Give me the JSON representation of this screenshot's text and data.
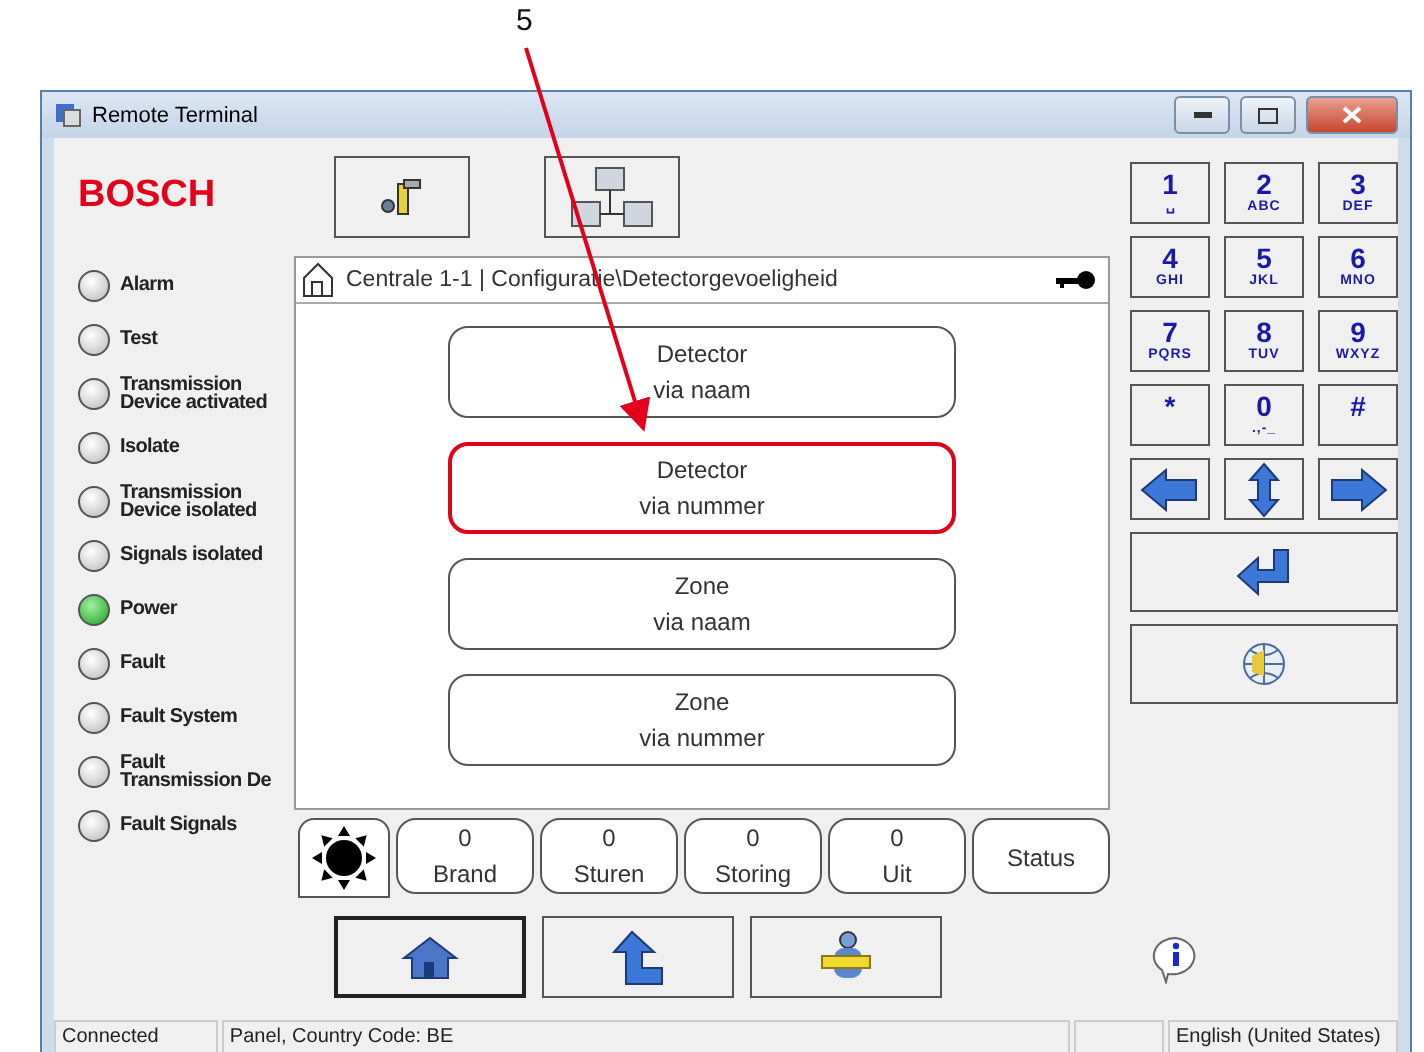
{
  "annotation": {
    "label": "5"
  },
  "window": {
    "title": "Remote Terminal"
  },
  "logo": "BOSCH",
  "indicators": [
    {
      "label": "Alarm",
      "on": false
    },
    {
      "label": "Test",
      "on": false
    },
    {
      "label": "Transmission\nDevice activated",
      "on": false
    },
    {
      "label": "Isolate",
      "on": false
    },
    {
      "label": "Transmission\nDevice isolated",
      "on": false
    },
    {
      "label": "Signals isolated",
      "on": false
    },
    {
      "label": "Power",
      "on": true
    },
    {
      "label": "Fault",
      "on": false
    },
    {
      "label": "Fault System",
      "on": false
    },
    {
      "label": "Fault\nTransmission De",
      "on": false
    },
    {
      "label": "Fault Signals",
      "on": false
    }
  ],
  "breadcrumb": "Centrale 1-1 | Configuratie\\Detectorgevoeligheid",
  "menu": [
    {
      "line1": "Detector",
      "line2": "via naam",
      "highlighted": false
    },
    {
      "line1": "Detector",
      "line2": "via nummer",
      "highlighted": true
    },
    {
      "line1": "Zone",
      "line2": "via naam",
      "highlighted": false
    },
    {
      "line1": "Zone",
      "line2": "via nummer",
      "highlighted": false
    }
  ],
  "counters": [
    {
      "count": "0",
      "label": "Brand"
    },
    {
      "count": "0",
      "label": "Sturen"
    },
    {
      "count": "0",
      "label": "Storing"
    },
    {
      "count": "0",
      "label": "Uit"
    }
  ],
  "status_button": "Status",
  "keypad": [
    {
      "main": "1",
      "sub": "␣"
    },
    {
      "main": "2",
      "sub": "ABC"
    },
    {
      "main": "3",
      "sub": "DEF"
    },
    {
      "main": "4",
      "sub": "GHI"
    },
    {
      "main": "5",
      "sub": "JKL"
    },
    {
      "main": "6",
      "sub": "MNO"
    },
    {
      "main": "7",
      "sub": "PQRS"
    },
    {
      "main": "8",
      "sub": "TUV"
    },
    {
      "main": "9",
      "sub": "WXYZ"
    },
    {
      "main": "*"
    },
    {
      "main": "0",
      "sub": ".,-_"
    },
    {
      "main": "#"
    }
  ],
  "status_bar": [
    "Connected",
    "Panel, Country Code: BE",
    "English (United States)"
  ]
}
